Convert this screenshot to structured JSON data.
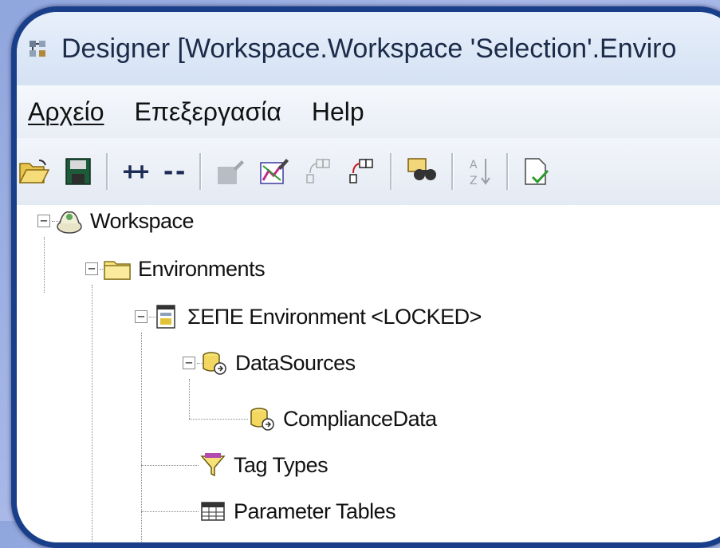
{
  "window": {
    "title": "Designer [Workspace.Workspace 'Selection'.Enviro"
  },
  "menu": {
    "items": [
      "Αρχείο",
      "Επεξεργασία",
      "Help"
    ]
  },
  "toolbar": {
    "buttons": [
      {
        "icon": "open-folder-icon"
      },
      {
        "icon": "save-icon"
      },
      {
        "label": "++",
        "icon": "expand-all-icon"
      },
      {
        "label": "--",
        "icon": "collapse-all-icon"
      },
      {
        "icon": "edit-disabled-icon"
      },
      {
        "icon": "edit-chart-icon"
      },
      {
        "icon": "copy-tree-disabled-icon"
      },
      {
        "icon": "copy-tree-icon"
      },
      {
        "icon": "find-icon"
      },
      {
        "icon": "sort-az-icon"
      },
      {
        "icon": "validate-icon"
      }
    ]
  },
  "tree": {
    "nodes": [
      {
        "label": "Workspace",
        "icon": "workspace-icon",
        "expander": "−"
      },
      {
        "label": "Environments",
        "icon": "folder-icon",
        "expander": "−"
      },
      {
        "label": "ΣΕΠΕ Environment <LOCKED>",
        "icon": "environment-icon",
        "expander": "−"
      },
      {
        "label": "DataSources",
        "icon": "datasources-icon",
        "expander": "−"
      },
      {
        "label": "ComplianceData",
        "icon": "datasource-icon"
      },
      {
        "label": "Tag Types",
        "icon": "tag-types-icon"
      },
      {
        "label": "Parameter Tables",
        "icon": "parameter-tables-icon"
      }
    ]
  },
  "colors": {
    "frame_border": "#1a3f8a",
    "background": "#9cb0e2",
    "folder_yellow": "#f7e27a"
  }
}
